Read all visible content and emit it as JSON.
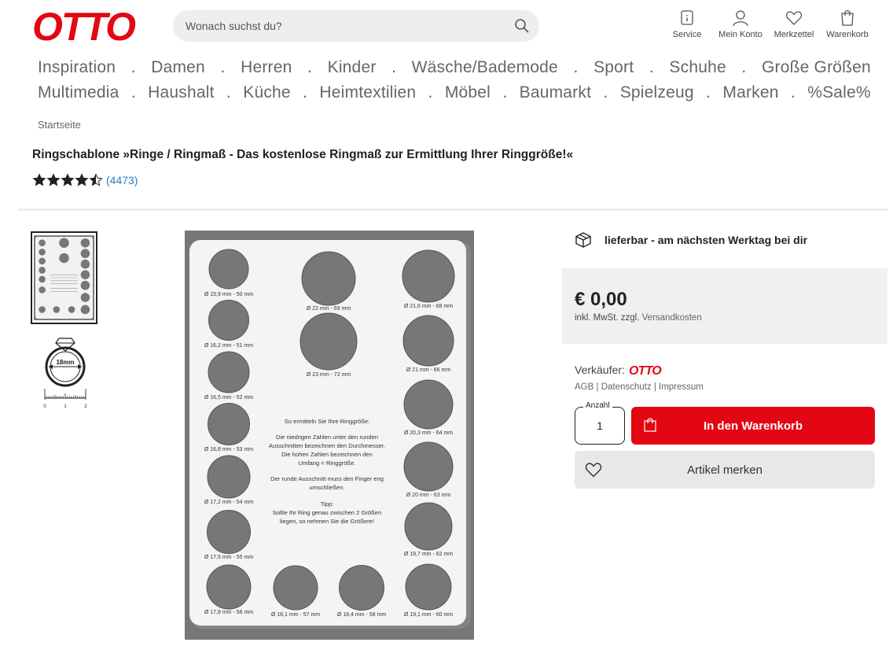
{
  "brand": {
    "logo_text": "OTTO",
    "color": "#e30613"
  },
  "search": {
    "placeholder": "Wonach suchst du?"
  },
  "header_icons": [
    {
      "label": "Service",
      "icon": "service-icon"
    },
    {
      "label": "Mein Konto",
      "icon": "user-icon"
    },
    {
      "label": "Merkzettel",
      "icon": "heart-icon"
    },
    {
      "label": "Warenkorb",
      "icon": "cart-icon"
    }
  ],
  "nav": {
    "row1": [
      "Inspiration",
      "Damen",
      "Herren",
      "Kinder",
      "Wäsche/Bademode",
      "Sport",
      "Schuhe",
      "Große Größen"
    ],
    "row2": [
      "Multimedia",
      "Haushalt",
      "Küche",
      "Heimtextilien",
      "Möbel",
      "Baumarkt",
      "Spielzeug",
      "Marken",
      "%Sale%"
    ],
    "separator": "."
  },
  "breadcrumb": "Startseite",
  "product": {
    "title": "Ringschablone »Ringe / Ringmaß - Das kostenlose Ringmaß zur Ermittlung Ihrer Ringgröße!«",
    "rating": 4.5,
    "rating_count": "(4473)"
  },
  "image": {
    "text_lines": [
      "So ermitteln Sie Ihre Ringgröße:",
      "Die niedrigen Zahlen unter den runden",
      "Ausschnitten bezeichnen den Durchmesser.",
      "Die hohen Zahlen bezeichnen den",
      "Umfang = Ringgröße.",
      "Der runde Ausschnitt muss den Finger eng",
      "umschließen.",
      "Tipp:",
      "Sollte Ihr Ring genau zwischen 2 Größen",
      "liegen, so nehmen Sie die Größere!"
    ],
    "left_labels": [
      "Ø 15,9 mm - 50 mm",
      "Ø 16,2 mm - 51 mm",
      "Ø 16,5 mm - 52 mm",
      "Ø 16,8 mm - 53 mm",
      "Ø 17,2 mm - 54 mm",
      "Ø 17,5 mm - 55 mm",
      "Ø 17,8 mm - 56 mm"
    ],
    "center_labels": [
      "Ø 22 mm - 69 mm",
      "Ø 23 mm - 72 mm"
    ],
    "right_labels": [
      "Ø 21,6 mm - 68 mm",
      "Ø 21 mm - 66 mm",
      "Ø 20,3 mm - 64 mm",
      "Ø 20 mm - 63 mm",
      "Ø 19,7 mm - 62 mm",
      "Ø 19,1 mm - 60 mm"
    ],
    "bottom_labels": [
      "Ø 18,1 mm - 57 mm",
      "Ø 18,4 mm - 58 mm"
    ],
    "ring_thumb_label": "18mm",
    "ruler_numbers": [
      "0",
      "1",
      "2"
    ]
  },
  "delivery": "lieferbar - am nächsten Werktag bei dir",
  "price": {
    "amount": "€ 0,00",
    "note": "inkl. MwSt. zzgl.",
    "shipping": "Versandkosten"
  },
  "seller": {
    "label": "Verkäufer:",
    "name": "OTTO"
  },
  "legal": [
    "AGB",
    "Datenschutz",
    "Impressum"
  ],
  "quantity": {
    "label": "Anzahl",
    "value": "1"
  },
  "buttons": {
    "cart": "In den Warenkorb",
    "remember": "Artikel merken"
  }
}
